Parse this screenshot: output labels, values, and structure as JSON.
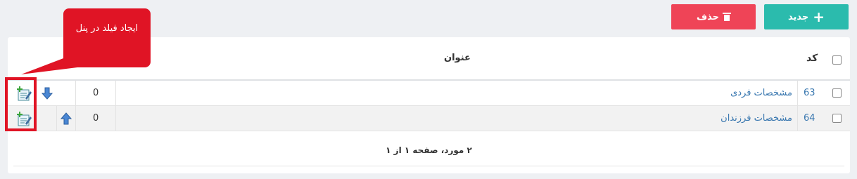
{
  "toolbar": {
    "new_label": "جدید",
    "delete_label": "حذف"
  },
  "table": {
    "headers": {
      "code": "کد",
      "title": "عنوان"
    },
    "rows": [
      {
        "code": "63",
        "title": "مشخصات فردی",
        "order": "0",
        "move": "down"
      },
      {
        "code": "64",
        "title": "مشخصات فرزندان",
        "order": "0",
        "move": "up"
      }
    ],
    "footer": "۲ مورد، صفحه ۱ از ۱"
  },
  "annotation": {
    "callout": "ایجاد فیلد در پنل"
  },
  "colors": {
    "new_button": "#2bbbad",
    "delete_button": "#ef4457",
    "link": "#3a78b0",
    "callout": "#e01425"
  },
  "icons": [
    "plus-icon",
    "trash-icon",
    "arrow-down-icon",
    "arrow-up-icon",
    "add-field-icon"
  ]
}
